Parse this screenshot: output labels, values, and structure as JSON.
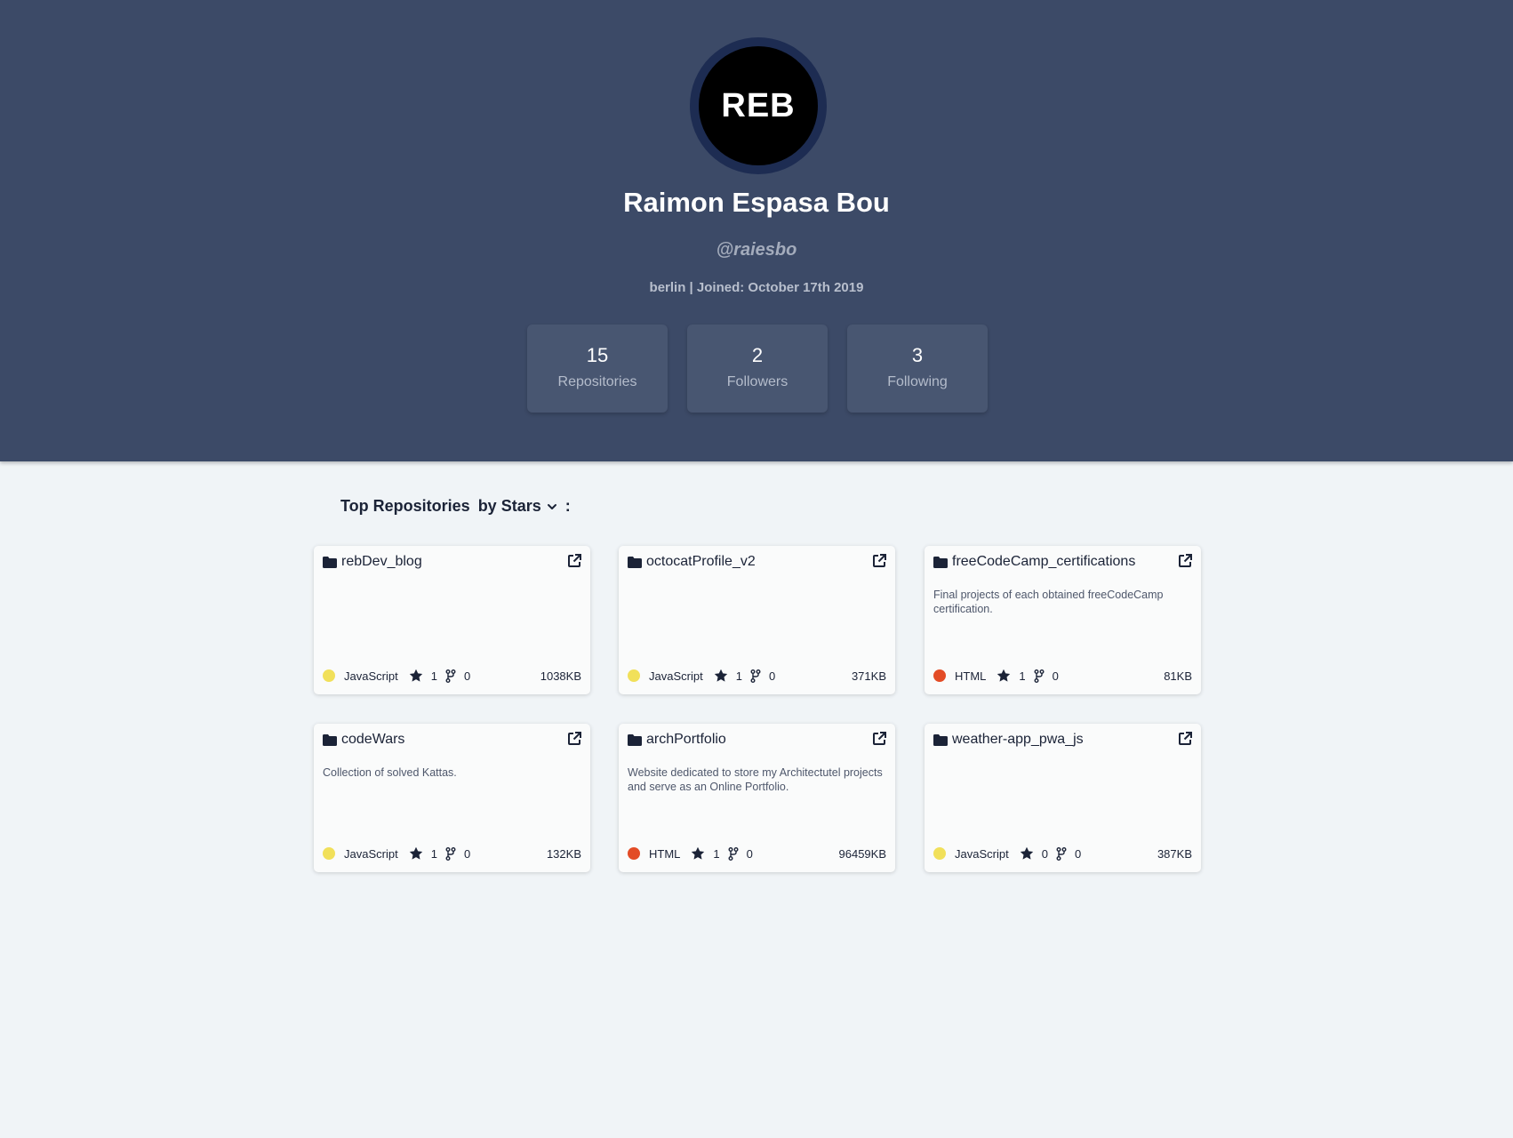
{
  "profile": {
    "avatar_text": "REB",
    "name": "Raimon Espasa Bou",
    "handle": "@raiesbo",
    "meta": "berlin | Joined: October 17th 2019"
  },
  "stats": [
    {
      "value": "15",
      "label": "Repositories"
    },
    {
      "value": "2",
      "label": "Followers"
    },
    {
      "value": "3",
      "label": "Following"
    }
  ],
  "section": {
    "title": "Top Repositories",
    "sort_label": "by Stars",
    "colon": ":"
  },
  "colors": {
    "header_bg": "#3c4a67",
    "page_bg": "#f0f4f7",
    "javascript": "#f1e05a",
    "html": "#e34c26"
  },
  "repos": [
    {
      "name": "rebDev_blog",
      "description": "",
      "language": "JavaScript",
      "lang_color": "#f1e05a",
      "stars": "1",
      "forks": "0",
      "size": "1038KB"
    },
    {
      "name": "octocatProfile_v2",
      "description": "",
      "language": "JavaScript",
      "lang_color": "#f1e05a",
      "stars": "1",
      "forks": "0",
      "size": "371KB"
    },
    {
      "name": "freeCodeCamp_certifications",
      "description": "Final projects of each obtained freeCodeCamp certification.",
      "language": "HTML",
      "lang_color": "#e34c26",
      "stars": "1",
      "forks": "0",
      "size": "81KB"
    },
    {
      "name": "codeWars",
      "description": "Collection of solved Kattas.",
      "language": "JavaScript",
      "lang_color": "#f1e05a",
      "stars": "1",
      "forks": "0",
      "size": "132KB"
    },
    {
      "name": "archPortfolio",
      "description": "Website dedicated to store my Architectutel projects and serve as an Online Portfolio.",
      "language": "HTML",
      "lang_color": "#e34c26",
      "stars": "1",
      "forks": "0",
      "size": "96459KB"
    },
    {
      "name": "weather-app_pwa_js",
      "description": "",
      "language": "JavaScript",
      "lang_color": "#f1e05a",
      "stars": "0",
      "forks": "0",
      "size": "387KB"
    }
  ]
}
